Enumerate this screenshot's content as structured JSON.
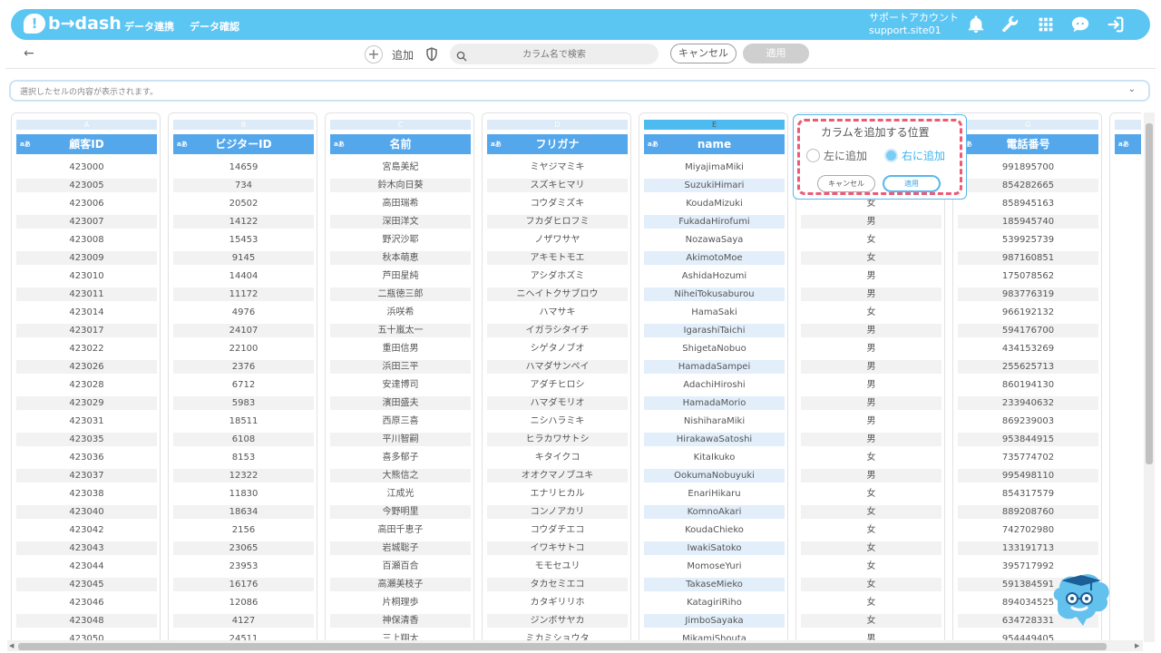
{
  "header": {
    "logo_mark": "!",
    "logo_text": "b→dash",
    "nav": [
      "データ連携",
      "データ確認"
    ],
    "account_name": "サポートアカウント",
    "account_site": "support.site01",
    "icons": [
      "bell-icon",
      "wrench-icon",
      "grid-icon",
      "chat-icon",
      "logout-icon"
    ],
    "accent_color": "#5cc6f3"
  },
  "toolbar": {
    "back_label": "←",
    "add_symbol": "+",
    "add_label": "追加",
    "search_placeholder": "カラム名で検索",
    "cancel_label": "キャンセル",
    "apply_label": "適用"
  },
  "cellbar": {
    "placeholder": "選択したセルの内容が表示されます。",
    "chevron": "⌄"
  },
  "popup": {
    "title": "カラムを追加する位置",
    "option_left": "左に追加",
    "option_right": "右に追加",
    "selected": "right",
    "cancel_label": "キャンセル",
    "apply_label": "適用"
  },
  "table": {
    "type_label": "aあ",
    "columns": [
      {
        "letter": "A",
        "name": "顧客ID"
      },
      {
        "letter": "B",
        "name": "ビジターID"
      },
      {
        "letter": "C",
        "name": "名前"
      },
      {
        "letter": "D",
        "name": "フリガナ"
      },
      {
        "letter": "E",
        "name": "name"
      },
      {
        "letter": "F",
        "name": ""
      },
      {
        "letter": "G",
        "name": "電話番号"
      },
      {
        "letter": "",
        "name": ""
      }
    ],
    "selected_column": 4,
    "rows": [
      [
        "423000",
        "14659",
        "宮島美紀",
        "ミヤジマミキ",
        "MiyajimaMiki",
        "",
        "991895700"
      ],
      [
        "423005",
        "734",
        "鈴木向日葵",
        "スズキヒマリ",
        "SuzukiHimari",
        "",
        "854282665"
      ],
      [
        "423006",
        "20502",
        "高田瑞希",
        "コウダミズキ",
        "KoudaMizuki",
        "女",
        "858945163"
      ],
      [
        "423007",
        "14122",
        "深田洋文",
        "フカダヒロフミ",
        "FukadaHirofumi",
        "男",
        "185945740"
      ],
      [
        "423008",
        "15453",
        "野沢沙耶",
        "ノザワサヤ",
        "NozawaSaya",
        "女",
        "539925739"
      ],
      [
        "423009",
        "9145",
        "秋本萌恵",
        "アキモトモエ",
        "AkimotoMoe",
        "女",
        "987160851"
      ],
      [
        "423010",
        "14404",
        "芦田星純",
        "アシダホズミ",
        "AshidaHozumi",
        "男",
        "175078562"
      ],
      [
        "423011",
        "11172",
        "二瓶徳三郎",
        "ニヘイトクサブロウ",
        "NiheiTokusaburou",
        "男",
        "983776319"
      ],
      [
        "423014",
        "4976",
        "浜咲希",
        "ハマサキ",
        "HamaSaki",
        "女",
        "966192132"
      ],
      [
        "423017",
        "24107",
        "五十嵐太一",
        "イガラシタイチ",
        "IgarashiTaichi",
        "男",
        "594176700"
      ],
      [
        "423022",
        "22100",
        "重田信男",
        "シゲタノブオ",
        "ShigetaNobuo",
        "男",
        "434153269"
      ],
      [
        "423026",
        "2376",
        "浜田三平",
        "ハマダサンペイ",
        "HamadaSampei",
        "男",
        "255625713"
      ],
      [
        "423028",
        "6712",
        "安達博司",
        "アダチヒロシ",
        "AdachiHiroshi",
        "男",
        "860194130"
      ],
      [
        "423029",
        "5983",
        "濱田盛夫",
        "ハマダモリオ",
        "HamadaMorio",
        "男",
        "233940632"
      ],
      [
        "423031",
        "18511",
        "西原三喜",
        "ニシハラミキ",
        "NishiharaMiki",
        "男",
        "869239003"
      ],
      [
        "423035",
        "6108",
        "平川智嗣",
        "ヒラカワサトシ",
        "HirakawaSatoshi",
        "男",
        "953844915"
      ],
      [
        "423036",
        "8153",
        "喜多郁子",
        "キタイクコ",
        "KitaIkuko",
        "女",
        "735774702"
      ],
      [
        "423037",
        "12322",
        "大熊信之",
        "オオクマノブユキ",
        "OokumaNobuyuki",
        "男",
        "995498110"
      ],
      [
        "423038",
        "11830",
        "江成光",
        "エナリヒカル",
        "EnariHikaru",
        "女",
        "854317579"
      ],
      [
        "423040",
        "18634",
        "今野明里",
        "コンノアカリ",
        "KomnoAkari",
        "女",
        "889208760"
      ],
      [
        "423042",
        "2156",
        "高田千恵子",
        "コウダチエコ",
        "KoudaChieko",
        "女",
        "742702980"
      ],
      [
        "423043",
        "23065",
        "岩城聡子",
        "イワキサトコ",
        "IwakiSatoko",
        "女",
        "133191713"
      ],
      [
        "423044",
        "23953",
        "百瀬百合",
        "モモセユリ",
        "MomoseYuri",
        "女",
        "395717992"
      ],
      [
        "423045",
        "16176",
        "高瀬美枝子",
        "タカセミエコ",
        "TakaseMieko",
        "女",
        "591384591"
      ],
      [
        "423046",
        "12086",
        "片桐理歩",
        "カタギリリホ",
        "KatagiriRiho",
        "女",
        "894034525"
      ],
      [
        "423048",
        "4127",
        "神保清香",
        "ジンボサヤカ",
        "JimboSayaka",
        "女",
        "634728331"
      ],
      [
        "423050",
        "24511",
        "三上翔太",
        "ミカミショウタ",
        "MikamiShouta",
        "男",
        "954449405"
      ]
    ]
  }
}
